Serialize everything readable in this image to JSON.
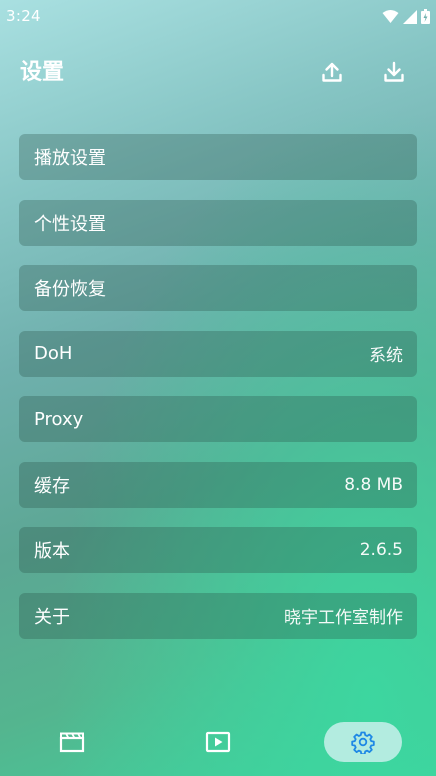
{
  "status_bar": {
    "time": "3:24",
    "icons": [
      "wifi-icon",
      "signal-icon",
      "battery-icon"
    ]
  },
  "header": {
    "title": "设置",
    "icons": [
      "upload-icon",
      "download-icon"
    ]
  },
  "settings": [
    {
      "label": "播放设置",
      "value": ""
    },
    {
      "label": "个性设置",
      "value": ""
    },
    {
      "label": "备份恢复",
      "value": ""
    },
    {
      "label": "DoH",
      "value": "系统"
    },
    {
      "label": "Proxy",
      "value": ""
    },
    {
      "label": "缓存",
      "value": "8.8 MB"
    },
    {
      "label": "版本",
      "value": "2.6.5"
    },
    {
      "label": "关于",
      "value": "晓宇工作室制作"
    }
  ],
  "bottom_nav": {
    "items": [
      "movie-icon",
      "play-icon",
      "gear-icon"
    ],
    "selected": "gear-icon"
  },
  "colors": {
    "settings_icon": "#1e88e5",
    "row_bg": "rgba(40,80,70,0.30)",
    "text": "#ffffff"
  }
}
